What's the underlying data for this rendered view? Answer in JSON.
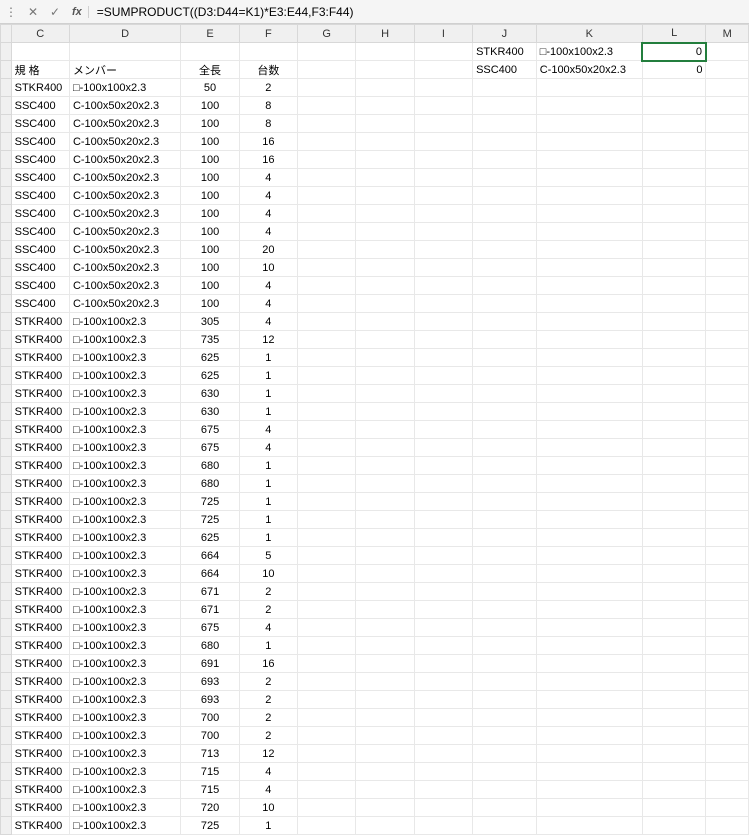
{
  "formula_bar": {
    "cancel": "✕",
    "enter": "✓",
    "fx_label": "fx",
    "formula": "=SUMPRODUCT((D3:D44=K1)*E3:E44,F3:F44)"
  },
  "columns": [
    "C",
    "D",
    "E",
    "F",
    "G",
    "H",
    "I",
    "J",
    "K",
    "L",
    "M"
  ],
  "headers": {
    "C": "規 格",
    "D": "メンバー",
    "E": "全長",
    "F": "台数"
  },
  "side": {
    "row1": {
      "J": "STKR400",
      "K": "□-100x100x2.3",
      "L": "0"
    },
    "row2": {
      "J": "SSC400",
      "K": "C-100x50x20x2.3",
      "L": "0"
    }
  },
  "rows": [
    {
      "C": "STKR400",
      "D": "□-100x100x2.3",
      "E": "50",
      "F": "2"
    },
    {
      "C": "SSC400",
      "D": "C-100x50x20x2.3",
      "E": "100",
      "F": "8"
    },
    {
      "C": "SSC400",
      "D": "C-100x50x20x2.3",
      "E": "100",
      "F": "8"
    },
    {
      "C": "SSC400",
      "D": "C-100x50x20x2.3",
      "E": "100",
      "F": "16"
    },
    {
      "C": "SSC400",
      "D": "C-100x50x20x2.3",
      "E": "100",
      "F": "16"
    },
    {
      "C": "SSC400",
      "D": "C-100x50x20x2.3",
      "E": "100",
      "F": "4"
    },
    {
      "C": "SSC400",
      "D": "C-100x50x20x2.3",
      "E": "100",
      "F": "4"
    },
    {
      "C": "SSC400",
      "D": "C-100x50x20x2.3",
      "E": "100",
      "F": "4"
    },
    {
      "C": "SSC400",
      "D": "C-100x50x20x2.3",
      "E": "100",
      "F": "4"
    },
    {
      "C": "SSC400",
      "D": "C-100x50x20x2.3",
      "E": "100",
      "F": "20"
    },
    {
      "C": "SSC400",
      "D": "C-100x50x20x2.3",
      "E": "100",
      "F": "10"
    },
    {
      "C": "SSC400",
      "D": "C-100x50x20x2.3",
      "E": "100",
      "F": "4"
    },
    {
      "C": "SSC400",
      "D": "C-100x50x20x2.3",
      "E": "100",
      "F": "4"
    },
    {
      "C": "STKR400",
      "D": "□-100x100x2.3",
      "E": "305",
      "F": "4"
    },
    {
      "C": "STKR400",
      "D": "□-100x100x2.3",
      "E": "735",
      "F": "12"
    },
    {
      "C": "STKR400",
      "D": "□-100x100x2.3",
      "E": "625",
      "F": "1"
    },
    {
      "C": "STKR400",
      "D": "□-100x100x2.3",
      "E": "625",
      "F": "1"
    },
    {
      "C": "STKR400",
      "D": "□-100x100x2.3",
      "E": "630",
      "F": "1"
    },
    {
      "C": "STKR400",
      "D": "□-100x100x2.3",
      "E": "630",
      "F": "1"
    },
    {
      "C": "STKR400",
      "D": "□-100x100x2.3",
      "E": "675",
      "F": "4"
    },
    {
      "C": "STKR400",
      "D": "□-100x100x2.3",
      "E": "675",
      "F": "4"
    },
    {
      "C": "STKR400",
      "D": "□-100x100x2.3",
      "E": "680",
      "F": "1"
    },
    {
      "C": "STKR400",
      "D": "□-100x100x2.3",
      "E": "680",
      "F": "1"
    },
    {
      "C": "STKR400",
      "D": "□-100x100x2.3",
      "E": "725",
      "F": "1"
    },
    {
      "C": "STKR400",
      "D": "□-100x100x2.3",
      "E": "725",
      "F": "1"
    },
    {
      "C": "STKR400",
      "D": "□-100x100x2.3",
      "E": "625",
      "F": "1"
    },
    {
      "C": "STKR400",
      "D": "□-100x100x2.3",
      "E": "664",
      "F": "5"
    },
    {
      "C": "STKR400",
      "D": "□-100x100x2.3",
      "E": "664",
      "F": "10"
    },
    {
      "C": "STKR400",
      "D": "□-100x100x2.3",
      "E": "671",
      "F": "2"
    },
    {
      "C": "STKR400",
      "D": "□-100x100x2.3",
      "E": "671",
      "F": "2"
    },
    {
      "C": "STKR400",
      "D": "□-100x100x2.3",
      "E": "675",
      "F": "4"
    },
    {
      "C": "STKR400",
      "D": "□-100x100x2.3",
      "E": "680",
      "F": "1"
    },
    {
      "C": "STKR400",
      "D": "□-100x100x2.3",
      "E": "691",
      "F": "16"
    },
    {
      "C": "STKR400",
      "D": "□-100x100x2.3",
      "E": "693",
      "F": "2"
    },
    {
      "C": "STKR400",
      "D": "□-100x100x2.3",
      "E": "693",
      "F": "2"
    },
    {
      "C": "STKR400",
      "D": "□-100x100x2.3",
      "E": "700",
      "F": "2"
    },
    {
      "C": "STKR400",
      "D": "□-100x100x2.3",
      "E": "700",
      "F": "2"
    },
    {
      "C": "STKR400",
      "D": "□-100x100x2.3",
      "E": "713",
      "F": "12"
    },
    {
      "C": "STKR400",
      "D": "□-100x100x2.3",
      "E": "715",
      "F": "4"
    },
    {
      "C": "STKR400",
      "D": "□-100x100x2.3",
      "E": "715",
      "F": "4"
    },
    {
      "C": "STKR400",
      "D": "□-100x100x2.3",
      "E": "720",
      "F": "10"
    },
    {
      "C": "STKR400",
      "D": "□-100x100x2.3",
      "E": "725",
      "F": "1"
    }
  ]
}
